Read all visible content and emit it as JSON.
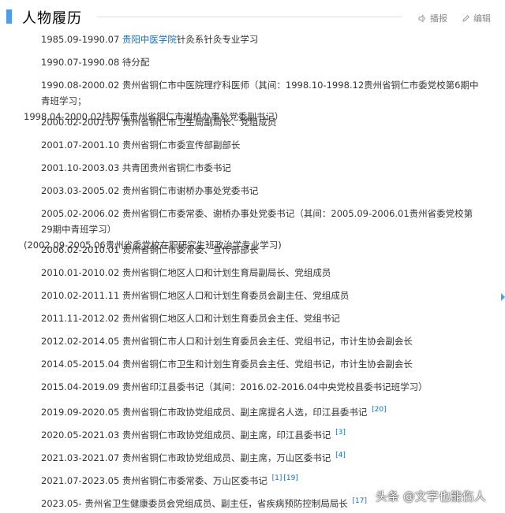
{
  "section": {
    "title": "人物履历",
    "report_label": "播报",
    "edit_label": "编辑"
  },
  "entries": [
    {
      "period": "1985.09-1990.07 ",
      "link": "贵阳中医学院",
      "text": "针灸系针灸专业学习"
    },
    {
      "text": "1990.07-1990.08 待分配"
    },
    {
      "text": "1990.08-2000.02 贵州省铜仁市中医院理疗科医师（其间：1998.10-1998.12贵州省铜仁市委党校第6期中青班学习；",
      "text2": "1998.04-2000.02挂职任贵州省铜仁市谢桥办事处党委副书记）"
    },
    {
      "text": "2000.02-2001.07 贵州省铜仁市卫生局副局长、党组成员"
    },
    {
      "text": "2001.07-2001.10 贵州省铜仁市委宣传部副部长"
    },
    {
      "text": "2001.10-2003.03 共青团贵州省铜仁市委书记"
    },
    {
      "text": "2003.03-2005.02 贵州省铜仁市谢桥办事处党委书记"
    },
    {
      "text": "2005.02-2006.02 贵州省铜仁市委常委、谢桥办事处党委书记（其间：2005.09-2006.01贵州省委党校第29期中青班学习）",
      "text2": "(2002.09-2005.06贵州省委党校在职研究生班政治学专业学习)"
    },
    {
      "text": "2006.02-2010.01 贵州省铜仁市委常委、宣传部部长"
    },
    {
      "text": "2010.01-2010.02 贵州省铜仁地区人口和计划生育局副局长、党组成员"
    },
    {
      "text": "2010.02-2011.11 贵州省铜仁地区人口和计划生育委员会副主任、党组成员"
    },
    {
      "text": "2011.11-2012.02 贵州省铜仁地区人口和计划生育委员会主任、党组书记"
    },
    {
      "text": "2012.02-2014.05 贵州省铜仁市人口和计划生育委员会主任、党组书记，市计生协会副会长"
    },
    {
      "text": "2014.05-2015.04 贵州省铜仁市卫生和计划生育委员会主任、党组书记，市计生协会副会长"
    },
    {
      "text": "2015.04-2019.09 贵州省印江县委书记（其间：2016.02-2016.04中央党校县委书记班学习）"
    },
    {
      "text": "2019.09-2020.05 贵州省铜仁市政协党组成员、副主席提名人选，印江县委书记 ",
      "refs": [
        "[20]"
      ]
    },
    {
      "text": "2020.05-2021.03  贵州省铜仁市政协党组成员、副主席，印江县委书记 ",
      "refs": [
        "[3]"
      ]
    },
    {
      "text": "2021.03-2021.07 贵州省铜仁市政协党组成员、副主席，万山区委书记 ",
      "refs": [
        "[4]"
      ]
    },
    {
      "text": "2021.07-2023.05 贵州省铜仁市委常委、万山区委书记 ",
      "refs": [
        "[1]",
        "[19]"
      ]
    },
    {
      "text": "2023.05- 贵州省卫生健康委员会党组成员、副主任，省疾病预防控制局局长 ",
      "refs": [
        "[17]"
      ]
    }
  ],
  "watermark": "头条 @文字也能伤人"
}
